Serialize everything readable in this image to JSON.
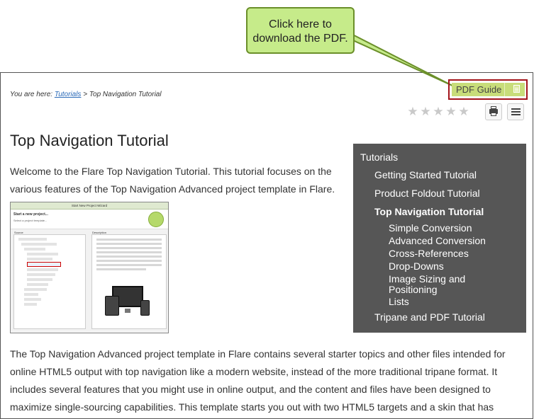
{
  "callout": {
    "text": "Click here to download the PDF."
  },
  "breadcrumb": {
    "prefix": "You are here:",
    "link": "Tutorials",
    "separator": ">",
    "current": "Top Navigation Tutorial"
  },
  "toolbar": {
    "pdf_label": "PDF Guide",
    "print_icon": "printer-icon",
    "list_icon": "list-icon",
    "rating_stars": 5
  },
  "page": {
    "title": "Top Navigation Tutorial",
    "intro": "Welcome to the Flare Top Navigation Tutorial. This tutorial focuses on the various features of the Top Navigation Advanced project template in Flare.",
    "body": "The Top Navigation Advanced project template in Flare contains several starter topics and other files intended for online HTML5 output with top navigation like a modern website, instead of the more traditional tripane format. It includes several features that you might use in online output, and the content and files have been designed to maximize single-sourcing capabilities. This template starts you out with two HTML5 targets and a skin that has"
  },
  "wizard": {
    "title": "Start New Project Wizard",
    "heading": "Start a new project...",
    "subheading": "Select a project template...",
    "source_label": "Source",
    "description_label": "Description"
  },
  "nav": {
    "root": "Tutorials",
    "items": [
      {
        "label": "Getting Started Tutorial"
      },
      {
        "label": "Product Foldout Tutorial"
      },
      {
        "label": "Top Navigation Tutorial"
      },
      {
        "label": "Tripane and PDF Tutorial"
      }
    ],
    "subitems": [
      {
        "label": "Simple Conversion"
      },
      {
        "label": "Advanced Conversion"
      },
      {
        "label": "Cross-References"
      },
      {
        "label": "Drop-Downs"
      },
      {
        "label": "Image Sizing and Positioning"
      },
      {
        "label": "Lists"
      }
    ]
  },
  "colors": {
    "callout_bg": "#c6eb8a",
    "pdf_button": "#c8dd7a",
    "highlight_border": "#a3141b",
    "nav_bg": "#565656",
    "link": "#2a6ab8"
  }
}
